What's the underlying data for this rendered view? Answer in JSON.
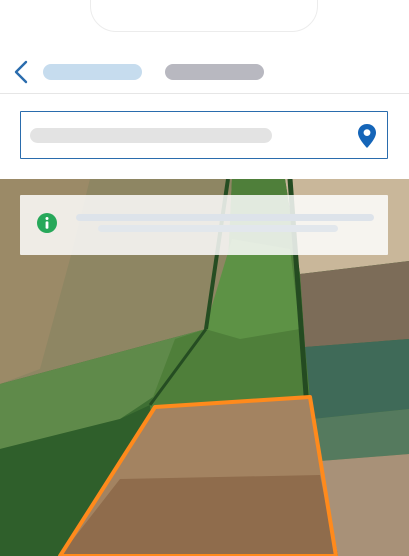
{
  "header": {
    "back_icon": "chevron-left-icon"
  },
  "location_field": {
    "value": "",
    "icon": "map-pin-icon"
  },
  "info_banner": {
    "icon": "info-circle-icon"
  },
  "map": {
    "type": "satellite",
    "field_outline_color": "#ff8a1c"
  },
  "colors": {
    "accent": "#2a6cad",
    "info": "#27a85a",
    "pin": "#1565b8"
  }
}
